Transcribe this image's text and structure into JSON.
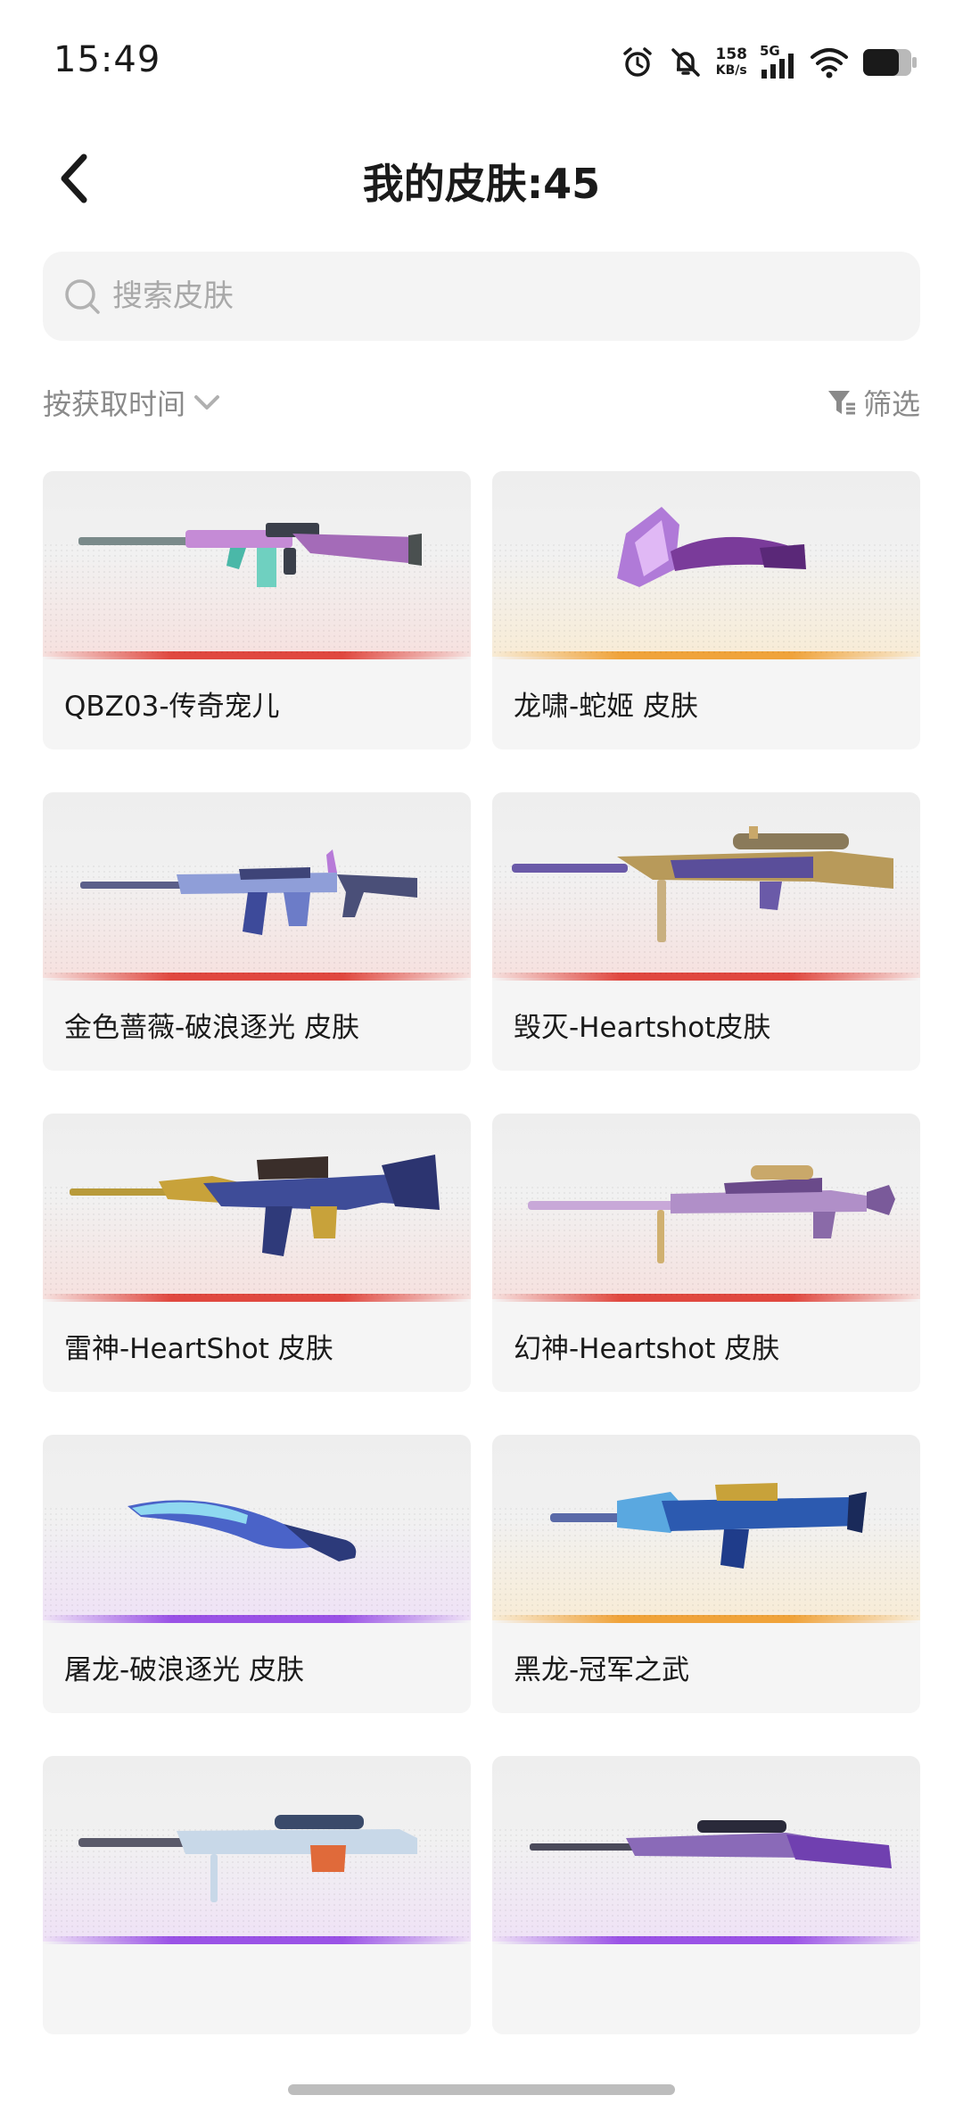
{
  "status_bar": {
    "time": "15:49",
    "net_speed_value": "158",
    "net_speed_unit": "KB/s",
    "signal_label": "5G",
    "icons": [
      "alarm-icon",
      "mute-icon",
      "signal-icon",
      "wifi-icon",
      "battery-icon"
    ]
  },
  "header": {
    "title": "我的皮肤:45",
    "back_icon": "chevron-left-icon"
  },
  "search": {
    "placeholder": "搜索皮肤",
    "value": ""
  },
  "toolbar": {
    "sort_label": "按获取时间",
    "filter_label": "筛选"
  },
  "colors": {
    "rarity_red": "#e0483f",
    "rarity_gold": "#f0a33a",
    "rarity_purple": "#9a52e6"
  },
  "skins": [
    {
      "name": "QBZ03-传奇宠儿",
      "rarity": "red",
      "weapon": "rifle"
    },
    {
      "name": "龙啸-蛇姬 皮肤",
      "rarity": "gold",
      "weapon": "axe"
    },
    {
      "name": "金色蔷薇-破浪逐光 皮肤",
      "rarity": "red",
      "weapon": "rifle"
    },
    {
      "name": "毁灭-Heartshot皮肤",
      "rarity": "red",
      "weapon": "sniper"
    },
    {
      "name": "雷神-HeartShot 皮肤",
      "rarity": "red",
      "weapon": "rifle"
    },
    {
      "name": "幻神-Heartshot 皮肤",
      "rarity": "red",
      "weapon": "sniper"
    },
    {
      "name": "屠龙-破浪逐光 皮肤",
      "rarity": "purple",
      "weapon": "knife"
    },
    {
      "name": "黑龙-冠军之武",
      "rarity": "gold",
      "weapon": "rifle"
    },
    {
      "name": "",
      "rarity": "purple",
      "weapon": "sniper"
    },
    {
      "name": "",
      "rarity": "purple",
      "weapon": "rifle"
    }
  ]
}
